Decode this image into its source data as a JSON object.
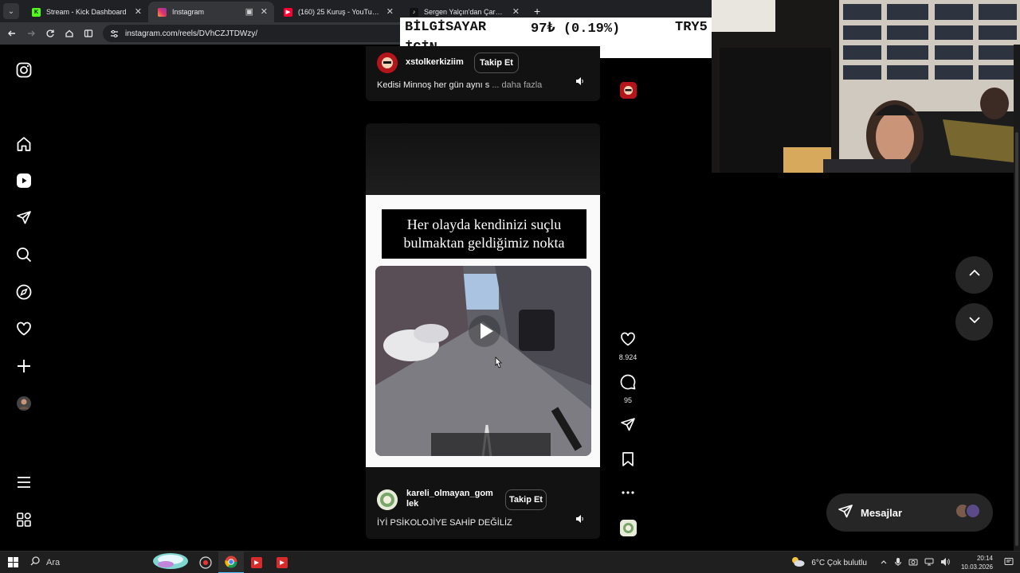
{
  "browser": {
    "tabs": [
      {
        "label": "Stream - Kick Dashboard",
        "icon": "kick-icon",
        "active": false
      },
      {
        "label": "Instagram",
        "icon": "instagram-icon",
        "active": true
      },
      {
        "label": "(160) 25 Kuruş - YouTube",
        "icon": "youtube-icon",
        "active": false
      },
      {
        "label": "Sergen Yalçın'dan Çarpıcı Açıkla",
        "icon": "tiktok-icon",
        "active": false
      }
    ],
    "url": "instagram.com/reels/DVhCZJTDWzy/"
  },
  "ticker": {
    "line1_left": "BİLGİSAYAR",
    "line1_mid": "97₺ (0.19%)",
    "line1_right": "TRY5",
    "line2": "İÇİN"
  },
  "sidebar": {
    "items": [
      "instagram-logo-icon",
      "home-icon",
      "reels-icon",
      "messages-icon",
      "search-icon",
      "explore-icon",
      "notifications-icon",
      "create-icon",
      "profile-avatar",
      "more-menu-icon",
      "also-from-meta-icon"
    ]
  },
  "prev_reel": {
    "username": "xstolkerkiziim",
    "follow_label": "Takip Et",
    "description": "Kedisi Minnoş her gün aynı s",
    "more_label": "... daha fazla"
  },
  "reel": {
    "caption_line1": "Her olayda kendinizi suçlu",
    "caption_line2": "bulmaktan geldiğimiz nokta",
    "username_line1": "kareli_olmayan_gom",
    "username_line2": "lek",
    "follow_label": "Takip Et",
    "description": "İYİ PSİKOLOJİYE SAHİP DEĞİLİZ",
    "likes": "8.924",
    "comments": "95"
  },
  "messages_label": "Mesajlar",
  "taskbar": {
    "search_label": "Ara",
    "weather": "6°C  Çok bulutlu",
    "time": "20:14",
    "date": "10.03.2026"
  },
  "colors": {
    "instagram_bg": "#000000",
    "panel": "#262626",
    "accent_kick": "#53fc18",
    "accent_youtube": "#ff0033"
  }
}
